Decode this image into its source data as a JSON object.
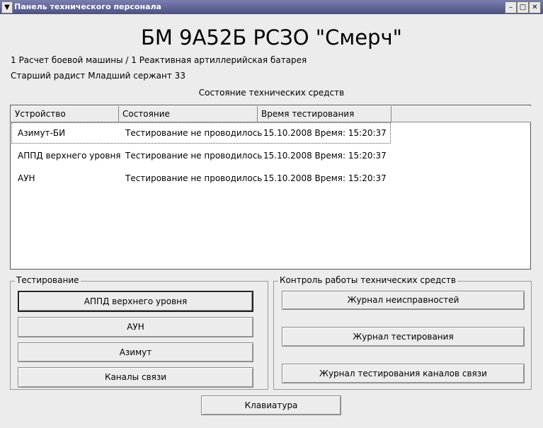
{
  "window": {
    "title": "Панель технического персонала",
    "menu_glyph": "▼",
    "minimize_glyph": "–",
    "maximize_glyph": "□",
    "close_glyph": "✕"
  },
  "header": {
    "title": "БМ 9А52Б РСЗО \"Смерч\"",
    "unit": "1 Расчет боевой машины / 1 Реактивная артиллерийская батарея",
    "operator": "Старший радист Младший сержант 33"
  },
  "status": {
    "title": "Состояние технических средств",
    "columns": [
      "Устройство",
      "Состояние",
      "Время тестирования"
    ],
    "rows": [
      {
        "device": "Азимут-БИ",
        "state": "Тестирование не проводилось",
        "time": "15.10.2008 Время: 15:20:37"
      },
      {
        "device": "АППД верхнего уровня",
        "state": "Тестирование не проводилось",
        "time": "15.10.2008 Время: 15:20:37"
      },
      {
        "device": "АУН",
        "state": "Тестирование не проводилось",
        "time": "15.10.2008 Время: 15:20:37"
      }
    ]
  },
  "testing": {
    "label": "Тестирование",
    "buttons": [
      "АППД верхнего уровня",
      "АУН",
      "Азимут",
      "Каналы связи"
    ]
  },
  "control": {
    "label": "Контроль работы технических средств",
    "buttons": [
      "Журнал неисправностей",
      "Журнал тестирования",
      "Журнал тестирования каналов связи"
    ]
  },
  "footer": {
    "keyboard_label": "Клавиатура"
  }
}
